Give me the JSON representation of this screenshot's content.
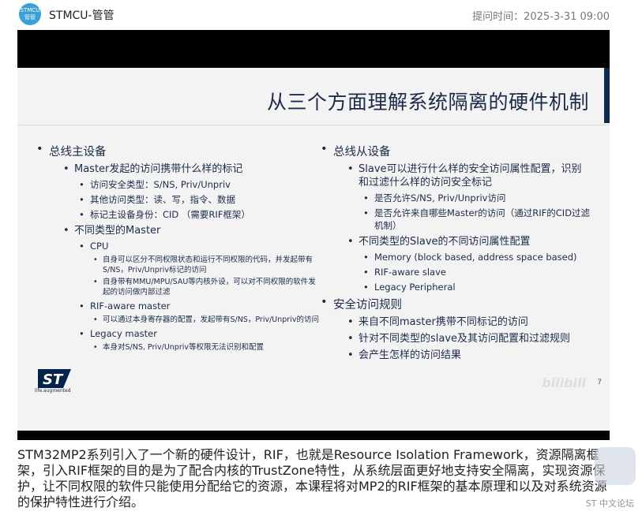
{
  "header": {
    "avatar_text_line1": "STMCU",
    "avatar_text_line2": "管管",
    "username": "STMCU-管管",
    "ask_time": "提问时间：2025-3-31 09:00"
  },
  "slide": {
    "title": "从三个方面理解系统隔离的硬件机制",
    "page_number": "7",
    "watermark": "bilibili",
    "logo_tagline": "life.augmented",
    "left": {
      "h1": "总线主设备",
      "a": "Master发起的访问携带什么样的标记",
      "a_items": [
        "访问安全类型：S/NS, Priv/Unpriv",
        "其他访问类型：读、写，指令、数据",
        "标记主设备身份：CID （需要RIF框架）"
      ],
      "b": "不同类型的Master",
      "cpu": "CPU",
      "cpu_items": [
        "自身可以区分不同权限状态和运行不同权限的代码，并发起带有S/NS，Priv/Unpriv标记的访问",
        "自身带有MMU/MPU/SAU等内核外设，可以对不同权限的软件发起的访问做内部过滤"
      ],
      "rif": "RIF-aware master",
      "rif_items": [
        "可以通过本身寄存器的配置，发起带有S/NS，Priv/Unpriv的访问"
      ],
      "legacy": "Legacy master",
      "legacy_items": [
        "本身对S/NS, Priv/Unpriv等权限无法识别和配置"
      ]
    },
    "right": {
      "h1": "总线从设备",
      "a": "Slave可以进行什么样的安全访问属性配置，识别和过滤什么样的访问安全标记",
      "a_items": [
        "是否允许S/NS, Priv/Unpriv访问",
        "是否允许来自哪些Master的访问（通过RIF的CID过滤机制）"
      ],
      "b": "不同类型的Slave的不同访问属性配置",
      "b_items": [
        "Memory (block based, address space based)",
        "RIF-aware slave",
        "Legacy Peripheral"
      ],
      "h2": "安全访问规则",
      "rules": [
        "来自不同master携带不同标记的访问",
        "针对不同类型的slave及其访问配置和过滤规则",
        "会产生怎样的访问结果"
      ]
    }
  },
  "description": "STM32MP2系列引入了一个新的硬件设计，RIF，也就是Resource Isolation Framework，资源隔离框架，引入RIF框架的目的是为了配合内核的TrustZone特性，从系统层面更好地支持安全隔离，实现资源保护，让不同权限的软件只能使用分配给它的资源，本课程将对MP2的RIF框架的基本原理和以及对系统资源的保护特性进行介绍。",
  "forum": {
    "label": "ST 中文论坛"
  },
  "colors": {
    "slide_bg": "#f3f3f3",
    "title_color": "#1c2b4a",
    "accent_bar": "#0b2a4d"
  }
}
